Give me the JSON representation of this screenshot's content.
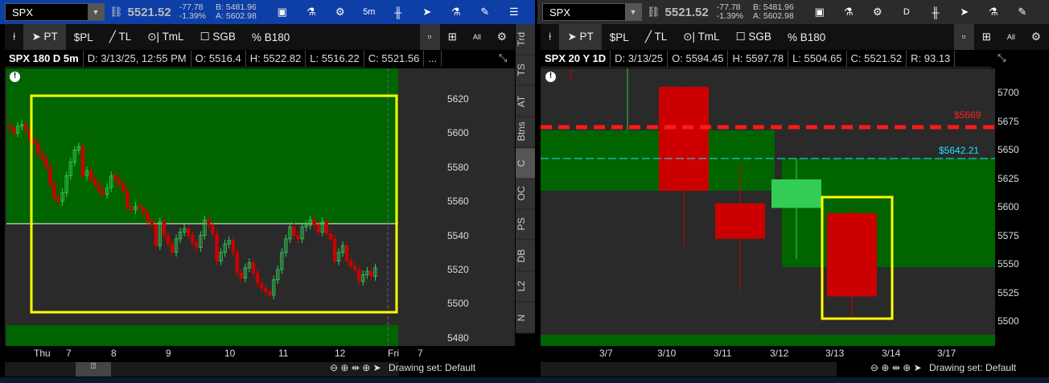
{
  "quote": {
    "symbol": "SPX",
    "last": "5521.52",
    "change": "-77.78",
    "change_pct": "-1.39%",
    "bid": "B: 5481.96",
    "ask": "A: 5602.98"
  },
  "left": {
    "interval_btn": "5m",
    "header": {
      "title": "SPX 180 D 5m",
      "date": "D: 3/13/25, 12:55 PM",
      "open": "O: 5516.4",
      "high": "H: 5522.82",
      "low": "L: 5516.22",
      "close": "C: 5521.56",
      "more": "..."
    },
    "price_ticks": [
      "5620",
      "5600",
      "5580",
      "5560",
      "5540",
      "5520",
      "5500",
      "5480"
    ],
    "time_ticks": [
      "Thu",
      "7",
      "8",
      "9",
      "10",
      "11",
      "12",
      "Fri",
      "7"
    ],
    "closes": [
      5603,
      5600,
      5604,
      5605,
      5602,
      5596,
      5594,
      5588,
      5585,
      5580,
      5570,
      5562,
      5560,
      5565,
      5575,
      5583,
      5590,
      5592,
      5575,
      5578,
      5573,
      5570,
      5566,
      5564,
      5568,
      5575,
      5573,
      5570,
      5566,
      5556,
      5555,
      5557,
      5556,
      5553,
      5548,
      5546,
      5534,
      5548,
      5540,
      5535,
      5530,
      5538,
      5542,
      5544,
      5540,
      5536,
      5533,
      5540,
      5549,
      5546,
      5541,
      5525,
      5530,
      5535,
      5537,
      5530,
      5518,
      5515,
      5521,
      5524,
      5518,
      5512,
      5509,
      5507,
      5505,
      5514,
      5520,
      5530,
      5538,
      5545,
      5540,
      5538,
      5545,
      5546,
      5549,
      5546,
      5542,
      5548,
      5541,
      5538,
      5525,
      5530,
      5534,
      5525,
      5522,
      5520,
      5513,
      5517,
      5519,
      5516,
      5521
    ],
    "side_tabs": [
      "Trd",
      "TS",
      "AT",
      "Btns",
      "C",
      "OC",
      "PS",
      "DB",
      "L2",
      "N"
    ]
  },
  "right": {
    "interval_btn": "D",
    "header": {
      "title": "SPX 20 Y 1D",
      "date": "D: 3/13/25",
      "open": "O: 5594.45",
      "high": "H: 5597.78",
      "low": "L: 5504.65",
      "close": "C: 5521.52",
      "range": "R: 93.13"
    },
    "price_ticks": [
      "5700",
      "5675",
      "5650",
      "5625",
      "5600",
      "5575",
      "5550",
      "5525",
      "5500"
    ],
    "time_ticks": [
      "3/7",
      "3/10",
      "3/11",
      "3/12",
      "3/13",
      "3/14",
      "3/17"
    ],
    "candles": [
      {
        "o": 5705,
        "h": 5705,
        "l": 5565,
        "c": 5614
      },
      {
        "o": 5603,
        "h": 5637,
        "l": 5527,
        "c": 5572
      },
      {
        "o": 5599,
        "h": 5642,
        "l": 5554,
        "c": 5624
      },
      {
        "o": 5594.45,
        "h": 5597.78,
        "l": 5504.65,
        "c": 5521.52
      }
    ],
    "red_level": "$5669",
    "cyan_level": "$5642.21"
  },
  "toolbar": [
    "PT",
    "$PL",
    "TL",
    "TmL",
    "SGB",
    "B180"
  ],
  "drawing_set": "Drawing set: Default",
  "colors": {
    "up": "#33cc55",
    "down": "#cc0000",
    "zone": "#006400",
    "yellow": "#ffff00"
  }
}
